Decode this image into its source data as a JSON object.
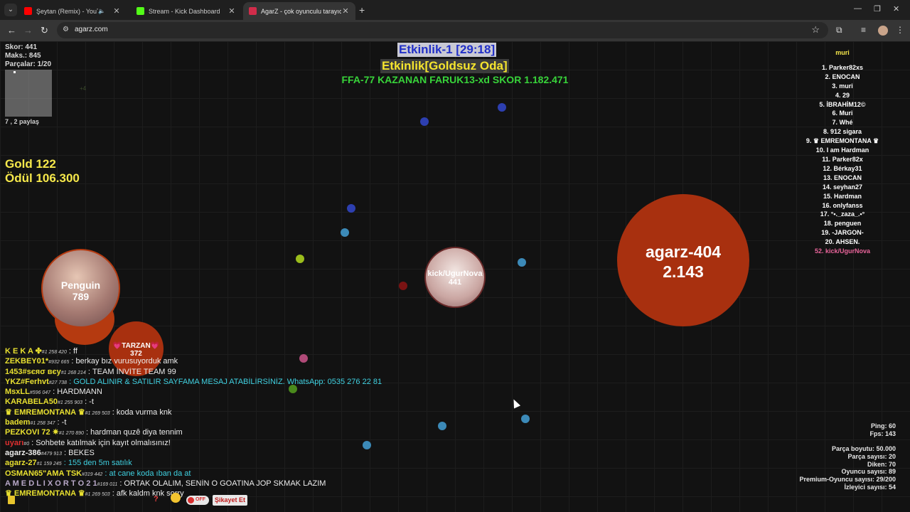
{
  "browser": {
    "tabs": [
      {
        "title": "Şeytan (Remix) - YouTube",
        "favicon_color": "#ff0000",
        "active": false,
        "muted": true
      },
      {
        "title": "Stream - Kick Dashboard",
        "favicon_color": "#53fc18",
        "active": false,
        "muted": false
      },
      {
        "title": "AgarZ - çok oyunculu tarayıcı o",
        "favicon_color": "#d12c4a",
        "active": true,
        "muted": false
      }
    ],
    "url": "agarz.com"
  },
  "hud": {
    "score": "Skor: 441",
    "max": "Maks.: 845",
    "parts": "Parçalar: 1/20",
    "minimap_caption": "7 , 2 paylaş",
    "plus_marker": "+4",
    "gold": "Gold 122",
    "reward": "Ödül 106.300"
  },
  "event": {
    "title": "Etkinlik-1 [29:18]",
    "room": "Etkinlik[Goldsuz Oda]",
    "winner": "FFA-77 KAZANAN FARUK13-xd SKOR 1.182.471"
  },
  "leaderboard": {
    "title": "muri",
    "entries": [
      "1. Parker82xs",
      "2. ENOCAN",
      "3. muri",
      "4. 29",
      "5. İBRAHİM12©",
      "6. Muri",
      "7. Whé",
      "8. 912 sigara",
      "9. ♛ EMREMONTANA ♛",
      "10. I am Hardman",
      "11. Parker82x",
      "12. Bérkay31",
      "13. ENOCAN",
      "14. seyhan27",
      "15. Hardman",
      "16. onlyfanss",
      "17. °•._zaza_.•°",
      "18. penguen",
      "19. -JARGON-",
      "20. AHSEN."
    ],
    "me": "52. kick/UgurNova"
  },
  "cells": {
    "player": {
      "name": "kick/UgurNova",
      "mass": "441"
    },
    "enemy": {
      "name": "agarz-404",
      "mass": "2.143"
    },
    "penguin": {
      "name": "Penguin",
      "mass": "789"
    },
    "tarzan": {
      "name": "💗TARZAN💗",
      "mass": "372"
    }
  },
  "chat": [
    {
      "name": "K E K A ✤",
      "id": "#1 258 420",
      "msg": ": ff",
      "name_color": "#e8e030",
      "msg_color": "#ededed"
    },
    {
      "name": "ZEKBEY01*",
      "id": "#932 665",
      "msg": ": berkay bız vurusuyorduk amk",
      "name_color": "#e8e030",
      "msg_color": "#ededed"
    },
    {
      "name": "1453#sєяσ вєу",
      "id": "#1 268 214",
      "msg": ": TEAM İNVİTE TEAM 99",
      "name_color": "#e8e030",
      "msg_color": "#ededed"
    },
    {
      "name": "YKZ#Ferhvt",
      "id": "#27 738",
      "msg": ": GOLD ALINIR & SATILIR SAYFAMA MESAJ ATABİLİRSİNİZ. WhatsApp: 0535 276 22 81",
      "name_color": "#e8e030",
      "msg_color": "#3fd0e0"
    },
    {
      "name": "MsxLL",
      "id": "#596 047",
      "msg": ": HARDMANN",
      "name_color": "#e8e030",
      "msg_color": "#ededed"
    },
    {
      "name": "KARABELA50",
      "id": "#1 255 903",
      "msg": ": -t",
      "name_color": "#e8e030",
      "msg_color": "#ededed"
    },
    {
      "name": "♛ EMREMONTANA ♛",
      "id": "#1 269 503",
      "msg": ": koda vurma knk",
      "name_color": "#e8e030",
      "msg_color": "#ededed"
    },
    {
      "name": "badem",
      "id": "#1 258 347",
      "msg": ": -t",
      "name_color": "#e8e030",
      "msg_color": "#ededed"
    },
    {
      "name": "PEZKOVI 72 ✷",
      "id": "#1 270 890",
      "msg": ": hardman quzê diya tennim",
      "name_color": "#e8e030",
      "msg_color": "#ededed"
    },
    {
      "name": "uyarı",
      "id": "#0",
      "msg": ": Sohbete katılmak için kayıt olmalısınız!",
      "name_color": "#e03030",
      "msg_color": "#ededed"
    },
    {
      "name": "agarz-386",
      "id": "#479 913",
      "msg": ": BEKES",
      "name_color": "#ededed",
      "msg_color": "#ededed"
    },
    {
      "name": "agarz-27",
      "id": "#1 159 245",
      "msg": ": 155 den 5m satılık",
      "name_color": "#e8e030",
      "msg_color": "#3fd0e0"
    },
    {
      "name": "OSMAN65\"AMA TSK",
      "id": "#319 442",
      "msg": ": at cane koda ıban da at",
      "name_color": "#e8e030",
      "msg_color": "#3fd0e0"
    },
    {
      "name": "A M E D L I  X O R T O 2 1",
      "id": "#169 011",
      "msg": ": ORTAK OLALIM, SENİN O GOATINA JOP SKMAK LAZIM",
      "name_color": "#b8a8c8",
      "msg_color": "#ededed"
    },
    {
      "name": "♛ EMREMONTANA ♛",
      "id": "#1 269 503",
      "msg": ": afk kaldm knk sorry",
      "name_color": "#e8e030",
      "msg_color": "#ededed"
    }
  ],
  "chat_bar": {
    "help": "?",
    "toggle": "OFF",
    "report": "Şikayet Et"
  },
  "net_stats": {
    "ping": "Ping: 60",
    "fps": "Fps: 143"
  },
  "server_stats": [
    "Parça boyutu: 50.000",
    "Parça sayısı: 20",
    "Diken: 70",
    "Oyuncu sayısı: 89",
    "Premium-Oyuncu sayısı: 29/200",
    "İzleyici sayısı: 54"
  ],
  "colors": {
    "enemy_cell": "#a8300f",
    "pellet_blue": "#2d3fb0",
    "pellet_cyan": "#3c8ab8",
    "pellet_lime": "#9bbd1c",
    "pellet_red": "#7a1313",
    "pellet_pink": "#b04a78",
    "pellet_green": "#4a8a1c"
  }
}
